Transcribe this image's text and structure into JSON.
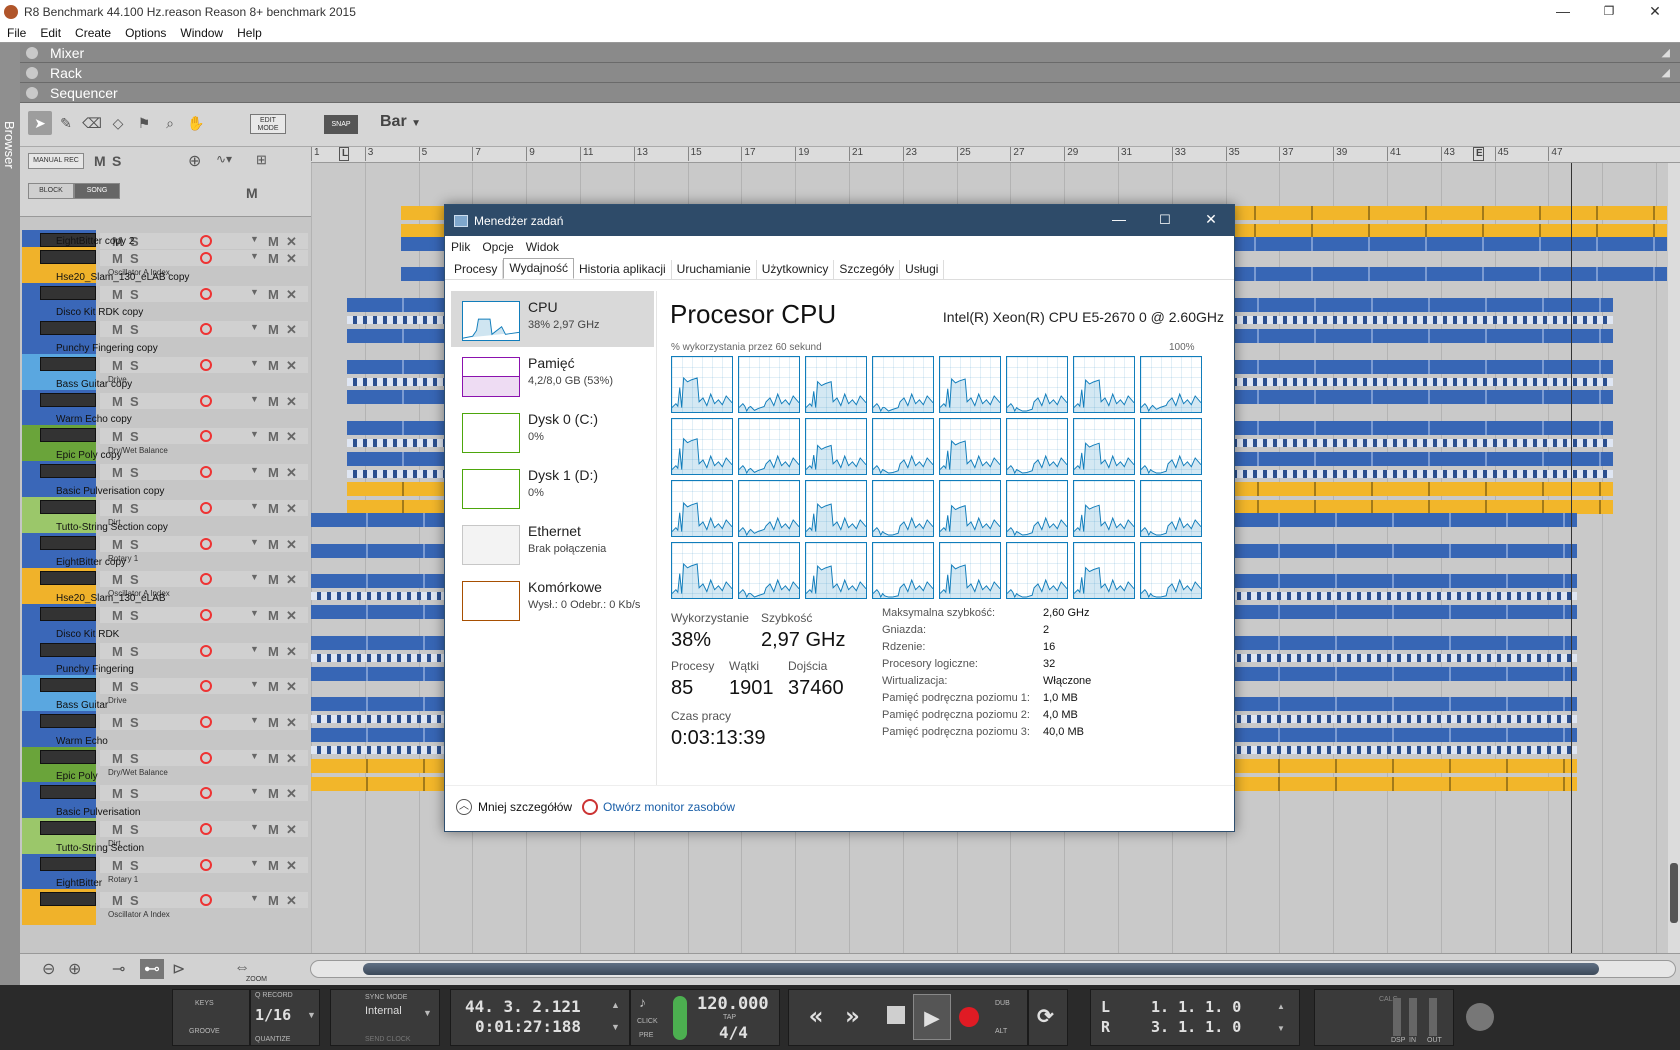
{
  "window": {
    "title": "R8 Benchmark 44.100 Hz.reason Reason 8+ benchmark 2015",
    "menu": [
      "File",
      "Edit",
      "Create",
      "Options",
      "Window",
      "Help"
    ],
    "minimize": "—",
    "maximize": "❐",
    "close": "✕"
  },
  "browser": {
    "label": "Browser"
  },
  "panels": {
    "mixer": "Mixer",
    "rack": "Rack",
    "sequencer": "Sequencer"
  },
  "toolbar": {
    "edit_mode": "EDIT MODE",
    "snap": "SNAP",
    "snap_value": "Bar",
    "tool_icons": [
      "pointer-icon",
      "pencil-icon",
      "eraser-icon",
      "razor-icon",
      "mute-tool-icon",
      "magnify-icon",
      "hand-icon"
    ]
  },
  "track_controls": {
    "manual_rec": "MANUAL REC",
    "m": "M",
    "s": "S",
    "block": "BLOCK",
    "song": "SONG",
    "m2": "M"
  },
  "ruler": {
    "ticks": [
      "1",
      "3",
      "5",
      "7",
      "9",
      "11",
      "13",
      "15",
      "17",
      "19",
      "21",
      "23",
      "25",
      "27",
      "29",
      "31",
      "33",
      "35",
      "37",
      "39",
      "41",
      "43",
      "45",
      "47"
    ],
    "left_marker": "L",
    "right_marker": "E"
  },
  "tracks": [
    {
      "name": "",
      "param": "Rotary 1",
      "color": "#3a67b8"
    },
    {
      "name": "EightBitter copy 2",
      "param": "Oscillator A Index",
      "color": "#f0b22a"
    },
    {
      "name": "Hse20_Slam_130_eLAB copy",
      "param": "",
      "color": "#3a67b8"
    },
    {
      "name": "Disco Kit RDK copy",
      "param": "",
      "color": "#3a67b8"
    },
    {
      "name": "Punchy Fingering copy",
      "param": "Drive",
      "color": "#5aa7e0"
    },
    {
      "name": "Bass Guitar copy",
      "param": "",
      "color": "#3a67b8"
    },
    {
      "name": "Warm Echo copy",
      "param": "Dry/Wet Balance",
      "color": "#6aa43a"
    },
    {
      "name": "Epic Poly copy",
      "param": "",
      "color": "#3a67b8"
    },
    {
      "name": "Basic Pulverisation copy",
      "param": "Dirt",
      "color": "#9bc76a"
    },
    {
      "name": "Tutto-String Section copy",
      "param": "Rotary 1",
      "color": "#3a67b8"
    },
    {
      "name": "EightBitter copy",
      "param": "Oscillator A Index",
      "color": "#f0b22a"
    },
    {
      "name": "Hse20_Slam_130_eLAB",
      "param": "",
      "color": "#3a67b8"
    },
    {
      "name": "Disco Kit RDK",
      "param": "",
      "color": "#3a67b8"
    },
    {
      "name": "Punchy Fingering",
      "param": "Drive",
      "color": "#5aa7e0"
    },
    {
      "name": "Bass Guitar",
      "param": "",
      "color": "#3a67b8"
    },
    {
      "name": "Warm Echo",
      "param": "Dry/Wet Balance",
      "color": "#6aa43a"
    },
    {
      "name": "Epic Poly",
      "param": "",
      "color": "#3a67b8"
    },
    {
      "name": "Basic Pulverisation",
      "param": "Dirt",
      "color": "#9bc76a"
    },
    {
      "name": "Tutto-String Section",
      "param": "Rotary 1",
      "color": "#3a67b8"
    },
    {
      "name": "EightBitter",
      "param": "Oscillator A Index",
      "color": "#f0b22a"
    }
  ],
  "zoom": {
    "label": "ZOOM"
  },
  "transport": {
    "keys": "KEYS",
    "groove": "GROOVE",
    "q_record": "Q RECORD",
    "quantize_value": "1/16",
    "quantize": "QUANTIZE",
    "sync_mode": "SYNC MODE",
    "sync_value": "Internal",
    "send_clock": "SEND CLOCK",
    "position_bars": "44.  3.  2.121",
    "position_time": "0:01:27:188",
    "click": "CLICK",
    "pre": "PRE",
    "tempo": "120.000",
    "tap": "TAP",
    "signature": "4/4",
    "dub": "DUB",
    "alt": "ALT",
    "loop_left_label": "L",
    "loop_left": "1.  1.  1.    0",
    "loop_right_label": "R",
    "loop_right": "3.  1.  1.    0",
    "dsp": "DSP",
    "in": "IN",
    "out": "OUT",
    "calc": "CALC"
  },
  "task_manager": {
    "title": "Menedżer zadań",
    "menu": [
      "Plik",
      "Opcje",
      "Widok"
    ],
    "tabs": [
      "Procesy",
      "Wydajność",
      "Historia aplikacji",
      "Uruchamianie",
      "Użytkownicy",
      "Szczegóły",
      "Usługi"
    ],
    "active_tab": "Wydajność",
    "sidebar": [
      {
        "name": "CPU",
        "detail": "38% 2,97 GHz",
        "color": "#117dbb"
      },
      {
        "name": "Pamięć",
        "detail": "4,2/8,0 GB (53%)",
        "color": "#8b12ae"
      },
      {
        "name": "Dysk 0 (C:)",
        "detail": "0%",
        "color": "#4da60c"
      },
      {
        "name": "Dysk 1 (D:)",
        "detail": "0%",
        "color": "#4da60c"
      },
      {
        "name": "Ethernet",
        "detail": "Brak połączenia",
        "color": "#c7c7c7"
      },
      {
        "name": "Komórkowe",
        "detail": "Wysł.: 0 Odebr.: 0 Kb/s",
        "color": "#a74f01"
      }
    ],
    "heading": "Procesor CPU",
    "cpu_model": "Intel(R) Xeon(R) CPU E5-2670 0 @ 2.60GHz",
    "graph_label": "% wykorzystania przez 60 sekund",
    "graph_max": "100%",
    "core_graph_levels": [
      0.62,
      0.1,
      0.55,
      0.08,
      0.6,
      0.05,
      0.58,
      0.12,
      0.64,
      0.1,
      0.52,
      0.06,
      0.6,
      0.06,
      0.56,
      0.05,
      0.6,
      0.12,
      0.58,
      0.05,
      0.55,
      0.06,
      0.56,
      0.05,
      0.62,
      0.08,
      0.58,
      0.04,
      0.6,
      0.05,
      0.55,
      0.04
    ],
    "stats": {
      "utilization_label": "Wykorzystanie",
      "utilization": "38%",
      "speed_label": "Szybkość",
      "speed": "2,97 GHz",
      "processes_label": "Procesy",
      "processes": "85",
      "threads_label": "Wątki",
      "threads": "1901",
      "handles_label": "Dojścia",
      "handles": "37460",
      "uptime_label": "Czas pracy",
      "uptime": "0:03:13:39"
    },
    "details": [
      {
        "k": "Maksymalna szybkość:",
        "v": "2,60 GHz"
      },
      {
        "k": "Gniazda:",
        "v": "2"
      },
      {
        "k": "Rdzenie:",
        "v": "16"
      },
      {
        "k": "Procesory logiczne:",
        "v": "32"
      },
      {
        "k": "Wirtualizacja:",
        "v": "Włączone"
      },
      {
        "k": "Pamięć podręczna poziomu 1:",
        "v": "1,0 MB"
      },
      {
        "k": "Pamięć podręczna poziomu 2:",
        "v": "4,0 MB"
      },
      {
        "k": "Pamięć podręczna poziomu 3:",
        "v": "40,0 MB"
      }
    ],
    "footer": {
      "less": "Mniej szczegółów",
      "monitor": "Otwórz monitor zasobów"
    }
  }
}
